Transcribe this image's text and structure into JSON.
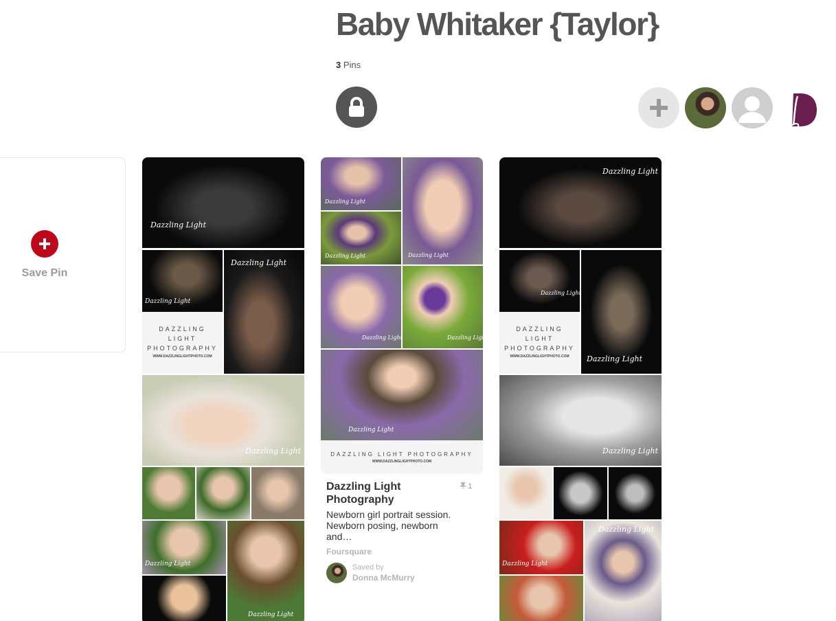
{
  "board": {
    "title": "Baby Whitaker {Taylor}",
    "pin_count": "3",
    "pin_count_label": " Pins"
  },
  "icons": {
    "lock": "lock-icon",
    "add": "plus-icon",
    "user": "user-icon",
    "logo": "dazzling-light-logo"
  },
  "colors": {
    "accent": "#bd081c",
    "title": "#555555",
    "muted": "#b5b5b5",
    "brand": "#6b1f4f"
  },
  "save_card": {
    "label": "Save Pin"
  },
  "watermark": {
    "brand": "Dazzling Light",
    "promo_lines": [
      "DAZZLING",
      "LIGHT",
      "PHOTOGRAPHY"
    ],
    "promo_wide": "DAZZLING LIGHT PHOTOGRAPHY",
    "url": "WWW.DAZZLINGLIGHTPHOTO.COM"
  },
  "pin2": {
    "title": "Dazzling Light Photography",
    "repin_count": "1",
    "description": "Newborn girl portrait session. Newborn posing, newborn and…",
    "source": "Foursquare",
    "saved_by_label": "Saved by",
    "saver_name": "Donna McMurry"
  }
}
